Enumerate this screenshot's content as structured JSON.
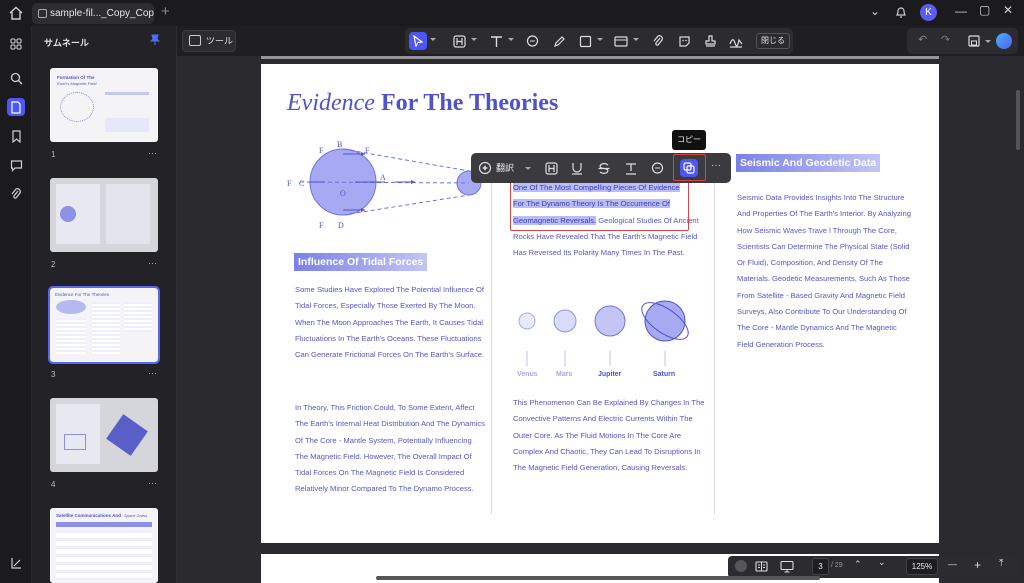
{
  "titlebar": {
    "tab_label": "sample-fil..._Copy_Copy",
    "avatar_letter": "K"
  },
  "thumbnails": {
    "title": "サムネール",
    "pages": [
      {
        "label": "1",
        "title": "Formation Of The",
        "subtitle": "Earth's Magnetic Field"
      },
      {
        "label": "2",
        "title": "",
        "subtitle": ""
      },
      {
        "label": "3",
        "title": "Evidence For The Theories",
        "subtitle": ""
      },
      {
        "label": "4",
        "title": "",
        "subtitle": ""
      },
      {
        "label": "",
        "title": "Satellite Communications And",
        "subtitle": "Space Grass"
      }
    ]
  },
  "toolbar": {
    "tools_label": "ツール",
    "close_label": "閉じる"
  },
  "floating_toolbar": {
    "translate_label": "翻訳",
    "tooltip": "コピー"
  },
  "page": {
    "heading_italic": "Evidence",
    "heading_bold": "For The Theories",
    "diagram_labels": {
      "b": "B",
      "fb": "F",
      "fc": "F",
      "fd": "F",
      "fe": "F",
      "c": "C",
      "o": "O",
      "a": "A",
      "d": "D"
    },
    "tidal_title": "Influence Of Tidal Forces",
    "tidal_para1": "Some Studies Have Explored The Potential Influence Of Tidal Forces, Especially Those Exerted By The Moon. When The Moon Approaches The Earth, It Causes Tidal Fluctuations In The Earth's Oceans. These Fluctuations Can Generate Frictional Forces On The Earth's Surface.",
    "tidal_para2": "In Theory, This Friction Could, To Some Extent, Affect The Earth's Internal Heat Distribution And The Dynamics Of The Core - Mantle System, Potentially Influencing The Magnetic Field. However, The Overall Impact Of Tidal Forces On The Magnetic Field Is Considered Relatively Minor Compared To The Dynamo Process.",
    "dynamo_selected_1": "One Of The Most Compelling Pieces Of Evidence",
    "dynamo_selected_2": "For The Dynamo Theory Is The Occurrence Of",
    "dynamo_selected_3": "Geomagnetic Reversals.",
    "dynamo_rest_1": " Geological Studies Of",
    "dynamo_rest_2": "Ancient Rocks Have Revealed That The Earth's Magnetic Field Has Reversed Its Polarity Many Times In The Past.",
    "planets": [
      "Venus",
      "Mars",
      "Jupiter",
      "Saturn"
    ],
    "dynamo_para2": "This Phenomenon Can Be Explained By Changes In The Convective Patterns And Electric Currents Within The Outer Core. As The Fluid Motions In The Core Are Complex And Chaotic, They Can Lead To Disruptions In The Magnetic Field Generation, Causing Reversals.",
    "seismic_title": "Seismic And Geodetic Data",
    "seismic_para": "Seismic Data Provides Insights Into The Structure And Properties Of The Earth's Interior. By Analyzing How Seismic Waves Trave l Through The Core, Scientists Can Determine The Physical State (Solid Or Fluid), Composition, And Density Of The Materials. Geodetic Measurements, Such As Those From Satellite - Based Gravity And Magnetic Field Surveys, Also Contribute To Our Understanding Of The Core - Mantle Dynamics And The Magnetic Field Generation Process."
  },
  "statusbar": {
    "current_page": "3",
    "total_pages": "/ 29",
    "zoom": "125%"
  }
}
